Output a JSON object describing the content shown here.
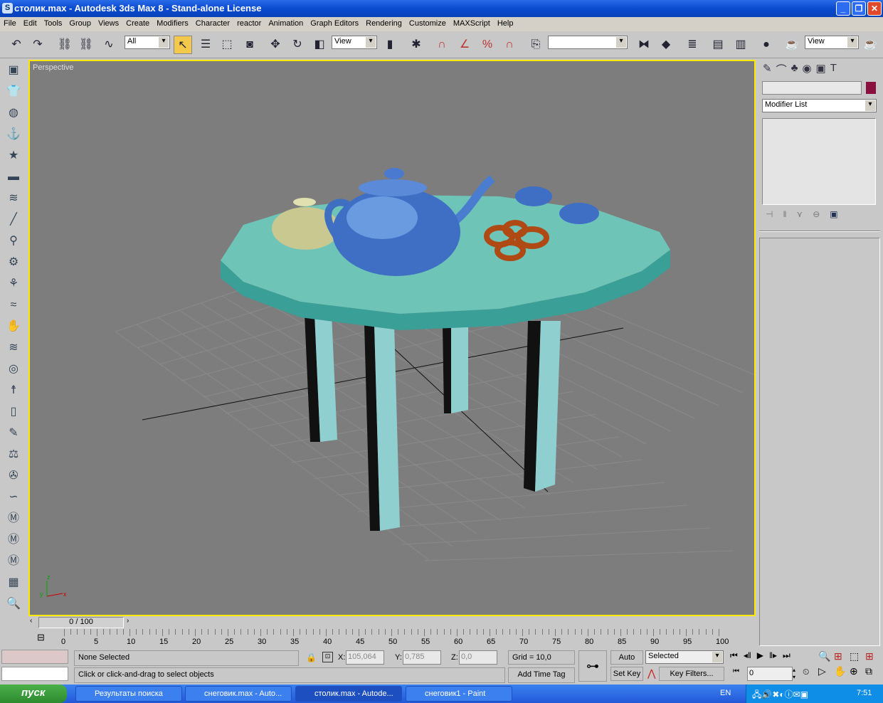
{
  "window": {
    "title": "столик.max - Autodesk 3ds Max 8  - Stand-alone License",
    "minimize": "_",
    "maximize": "❐",
    "close": "✕"
  },
  "menu": [
    "File",
    "Edit",
    "Tools",
    "Group",
    "Views",
    "Create",
    "Modifiers",
    "Character",
    "reactor",
    "Animation",
    "Graph Editors",
    "Rendering",
    "Customize",
    "MAXScript",
    "Help"
  ],
  "toolbar": {
    "selection_filter": "All",
    "ref_coord": "View",
    "named_sel": "",
    "render_view": "View"
  },
  "viewport": {
    "label": "Perspective"
  },
  "command_panel": {
    "name_field": "",
    "object_color": "#8a1040",
    "modifier_list": "Modifier List"
  },
  "timeline": {
    "frame": "0 / 100",
    "ticks": [
      "0",
      "5",
      "10",
      "15",
      "20",
      "25",
      "30",
      "35",
      "40",
      "45",
      "50",
      "55",
      "60",
      "65",
      "70",
      "75",
      "80",
      "85",
      "90",
      "95",
      "100"
    ]
  },
  "status": {
    "selection": "None Selected",
    "prompt": "Click or click-and-drag to select objects",
    "x_label": "X:",
    "x": "105,064",
    "y_label": "Y:",
    "y": "0,785",
    "z_label": "Z:",
    "z": "0,0",
    "grid": "Grid = 10,0",
    "add_time_tag": "Add Time Tag",
    "auto_key": "Auto Key",
    "set_key": "Set Key",
    "key_mode": "Selected",
    "key_filters": "Key Filters...",
    "current_frame": "0"
  },
  "taskbar": {
    "start": "пуск",
    "tasks": [
      {
        "label": "Результаты поиска",
        "active": false
      },
      {
        "label": "снеговик.max - Auto...",
        "active": false
      },
      {
        "label": "столик.max - Autode...",
        "active": true
      },
      {
        "label": "снеговик1 - Paint",
        "active": false
      }
    ],
    "lang": "EN",
    "clock": "7:51"
  }
}
